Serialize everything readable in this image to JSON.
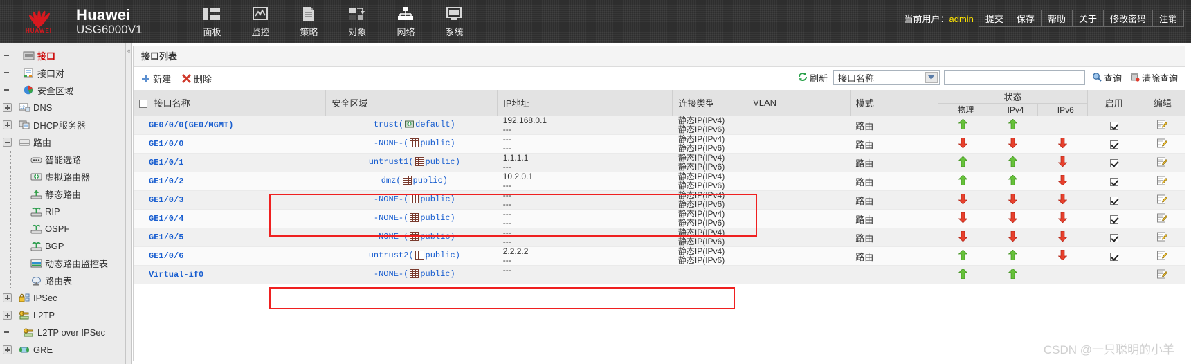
{
  "header": {
    "brand_name": "Huawei",
    "brand_model": "USG6000V1",
    "logo_text": "HUAWEI",
    "nav": [
      {
        "label": "面板",
        "icon": "dashboard-icon"
      },
      {
        "label": "监控",
        "icon": "monitor-icon"
      },
      {
        "label": "策略",
        "icon": "policy-icon"
      },
      {
        "label": "对象",
        "icon": "object-icon"
      },
      {
        "label": "网络",
        "icon": "network-icon"
      },
      {
        "label": "系统",
        "icon": "system-icon"
      }
    ],
    "current_user_label": "当前用户：",
    "current_user": "admin",
    "links": [
      "提交",
      "保存",
      "帮助",
      "关于",
      "修改密码",
      "注销"
    ],
    "accent_user_color": "#ffe500"
  },
  "sidebar": {
    "items": [
      {
        "label": "接口",
        "icon": "interface-icon",
        "toggle": "none",
        "level": 0,
        "selected": true
      },
      {
        "label": "接口对",
        "icon": "interface-pair-icon",
        "toggle": "none",
        "level": 0,
        "selected": false
      },
      {
        "label": "安全区域",
        "icon": "security-zone-icon",
        "toggle": "none",
        "level": 0,
        "selected": false
      },
      {
        "label": "DNS",
        "icon": "dns-icon",
        "toggle": "plus",
        "level": 0,
        "selected": false
      },
      {
        "label": "DHCP服务器",
        "icon": "dhcp-icon",
        "toggle": "plus",
        "level": 0,
        "selected": false
      },
      {
        "label": "路由",
        "icon": "route-icon",
        "toggle": "minus",
        "level": 0,
        "selected": false
      },
      {
        "label": "智能选路",
        "icon": "smart-route-icon",
        "toggle": "none",
        "level": 1,
        "selected": false
      },
      {
        "label": "虚拟路由器",
        "icon": "virtual-router-icon",
        "toggle": "none",
        "level": 1,
        "selected": false
      },
      {
        "label": "静态路由",
        "icon": "static-route-icon",
        "toggle": "none",
        "level": 1,
        "selected": false
      },
      {
        "label": "RIP",
        "icon": "rip-icon",
        "toggle": "none",
        "level": 1,
        "selected": false
      },
      {
        "label": "OSPF",
        "icon": "ospf-icon",
        "toggle": "none",
        "level": 1,
        "selected": false
      },
      {
        "label": "BGP",
        "icon": "bgp-icon",
        "toggle": "none",
        "level": 1,
        "selected": false
      },
      {
        "label": "动态路由监控表",
        "icon": "dynamic-route-monitor-icon",
        "toggle": "none",
        "level": 1,
        "selected": false
      },
      {
        "label": "路由表",
        "icon": "route-table-icon",
        "toggle": "none",
        "level": 1,
        "selected": false
      },
      {
        "label": "IPSec",
        "icon": "ipsec-icon",
        "toggle": "plus",
        "level": 0,
        "selected": false
      },
      {
        "label": "L2TP",
        "icon": "l2tp-icon",
        "toggle": "plus",
        "level": 0,
        "selected": false
      },
      {
        "label": "L2TP over IPSec",
        "icon": "l2tp-over-ipsec-icon",
        "toggle": "none",
        "level": 0,
        "selected": false
      },
      {
        "label": "GRE",
        "icon": "gre-icon",
        "toggle": "plus",
        "level": 0,
        "selected": false
      }
    ]
  },
  "panel": {
    "title": "接口列表",
    "toolbar": {
      "new_label": "新建",
      "delete_label": "删除",
      "refresh_label": "刷新",
      "filter_selected": "接口名称",
      "filter_options": [
        "接口名称"
      ],
      "search_value": "",
      "search_placeholder": "",
      "query_label": "查询",
      "clear_query_label": "清除查询"
    },
    "columns": {
      "name": "接口名称",
      "zone": "安全区域",
      "ip": "IP地址",
      "conn_type": "连接类型",
      "vlan": "VLAN",
      "mode": "模式",
      "status": "状态",
      "status_phy": "物理",
      "status_ipv4": "IPv4",
      "status_ipv6": "IPv6",
      "enable": "启用",
      "edit": "编辑"
    },
    "rows": [
      {
        "name": "GE0/0/0(GE0/MGMT)",
        "zone": "trust",
        "zone_vr": "default",
        "ip4": "192.168.0.1",
        "ip6": "---",
        "conn4": "静态IP(IPv4)",
        "conn6": "静态IP(IPv6)",
        "vlan": "",
        "mode": "路由",
        "phy": "up",
        "s4": "up",
        "s6": "",
        "enabled": true,
        "edit": true
      },
      {
        "name": "GE1/0/0",
        "zone": "-NONE-",
        "zone_vr": "public",
        "ip4": "---",
        "ip6": "---",
        "conn4": "静态IP(IPv4)",
        "conn6": "静态IP(IPv6)",
        "vlan": "",
        "mode": "路由",
        "phy": "down",
        "s4": "down",
        "s6": "down",
        "enabled": true,
        "edit": true
      },
      {
        "name": "GE1/0/1",
        "zone": "untrust1",
        "zone_vr": "public",
        "ip4": "1.1.1.1",
        "ip6": "---",
        "conn4": "静态IP(IPv4)",
        "conn6": "静态IP(IPv6)",
        "vlan": "",
        "mode": "路由",
        "phy": "up",
        "s4": "up",
        "s6": "down",
        "enabled": true,
        "edit": true
      },
      {
        "name": "GE1/0/2",
        "zone": "dmz",
        "zone_vr": "public",
        "ip4": "10.2.0.1",
        "ip6": "---",
        "conn4": "静态IP(IPv4)",
        "conn6": "静态IP(IPv6)",
        "vlan": "",
        "mode": "路由",
        "phy": "up",
        "s4": "up",
        "s6": "down",
        "enabled": true,
        "edit": true
      },
      {
        "name": "GE1/0/3",
        "zone": "-NONE-",
        "zone_vr": "public",
        "ip4": "---",
        "ip6": "---",
        "conn4": "静态IP(IPv4)",
        "conn6": "静态IP(IPv6)",
        "vlan": "",
        "mode": "路由",
        "phy": "down",
        "s4": "down",
        "s6": "down",
        "enabled": true,
        "edit": true
      },
      {
        "name": "GE1/0/4",
        "zone": "-NONE-",
        "zone_vr": "public",
        "ip4": "---",
        "ip6": "---",
        "conn4": "静态IP(IPv4)",
        "conn6": "静态IP(IPv6)",
        "vlan": "",
        "mode": "路由",
        "phy": "down",
        "s4": "down",
        "s6": "down",
        "enabled": true,
        "edit": true
      },
      {
        "name": "GE1/0/5",
        "zone": "-NONE-",
        "zone_vr": "public",
        "ip4": "---",
        "ip6": "---",
        "conn4": "静态IP(IPv4)",
        "conn6": "静态IP(IPv6)",
        "vlan": "",
        "mode": "路由",
        "phy": "down",
        "s4": "down",
        "s6": "down",
        "enabled": true,
        "edit": true
      },
      {
        "name": "GE1/0/6",
        "zone": "untrust2",
        "zone_vr": "public",
        "ip4": "2.2.2.2",
        "ip6": "---",
        "conn4": "静态IP(IPv4)",
        "conn6": "静态IP(IPv6)",
        "vlan": "",
        "mode": "路由",
        "phy": "up",
        "s4": "up",
        "s6": "down",
        "enabled": true,
        "edit": true
      },
      {
        "name": "Virtual-if0",
        "zone": "-NONE-",
        "zone_vr": "public",
        "ip4": "---",
        "ip6": "",
        "conn4": "",
        "conn6": "",
        "vlan": "",
        "mode": "",
        "phy": "up",
        "s4": "up",
        "s6": "",
        "enabled": false,
        "edit": true
      }
    ]
  },
  "annotations": {
    "highlight_color": "#ef2020",
    "boxes": [
      "rows-ge1-0-1-and-ge1-0-2",
      "row-ge1-0-6"
    ]
  },
  "watermark": "CSDN @一只聪明的小羊"
}
